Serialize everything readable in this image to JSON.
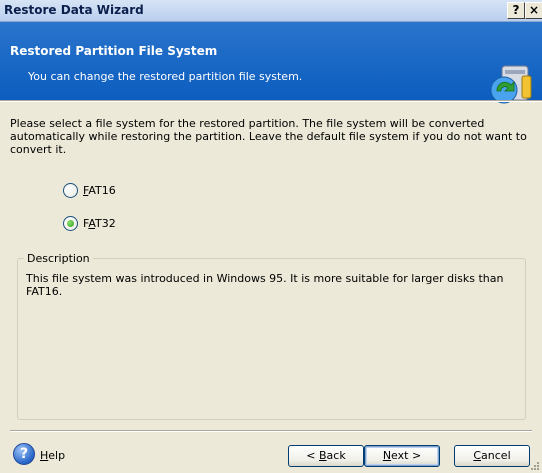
{
  "window": {
    "title": "Restore Data Wizard",
    "help_button": "?",
    "close_button": "×"
  },
  "header": {
    "title": "Restored Partition File System",
    "subtitle": "You can change the restored partition file system."
  },
  "intro_text": "Please select a file system for the restored partition. The file system will be converted automatically while restoring the partition. Leave the default file system if you do not want to convert it.",
  "options": [
    {
      "label": "FAT16",
      "checked": false
    },
    {
      "label": "FAT32",
      "checked": true
    }
  ],
  "description": {
    "legend": "Description",
    "text": "This file system was introduced in Windows 95. It is more suitable for larger disks than FAT16."
  },
  "footer": {
    "help_label": "Help",
    "back_label": "< Back",
    "next_label": "Next >",
    "cancel_label": "Cancel"
  }
}
